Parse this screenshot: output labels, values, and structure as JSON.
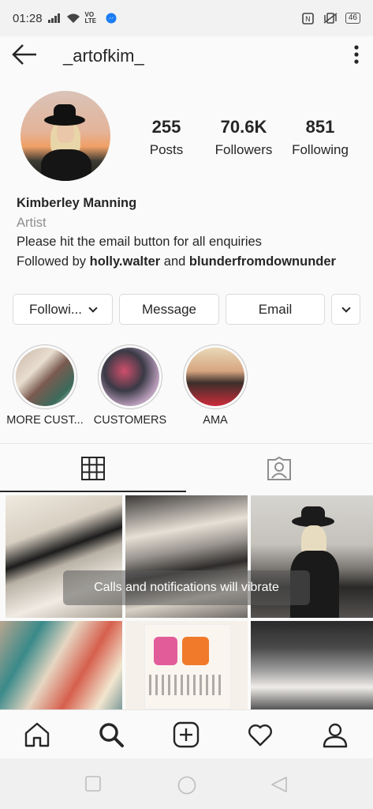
{
  "status_bar": {
    "time": "01:28",
    "network": "VO LTE",
    "battery": "46"
  },
  "header": {
    "username": "_artofkim_"
  },
  "profile": {
    "posts": "255",
    "posts_label": "Posts",
    "followers": "70.6K",
    "followers_label": "Followers",
    "following": "851",
    "following_label": "Following",
    "name": "Kimberley Manning",
    "category": "Artist",
    "bio": "Please hit the email button for all enquiries",
    "followed_by_prefix": "Followed by ",
    "followed_by_1": "holly.walter",
    "followed_by_and": " and ",
    "followed_by_2": "blunderfromdownunder"
  },
  "buttons": {
    "following": "Followi...",
    "message": "Message",
    "email": "Email"
  },
  "highlights": [
    {
      "label": "MORE CUST..."
    },
    {
      "label": "CUSTOMERS"
    },
    {
      "label": "AMA"
    }
  ],
  "toast": "Calls and notifications will vibrate",
  "icons": {
    "back": "back-arrow-icon",
    "more": "more-vertical-icon",
    "grid": "grid-icon",
    "tagged": "tagged-person-icon",
    "home": "home-icon",
    "search": "search-icon",
    "add": "add-post-icon",
    "activity": "heart-icon",
    "profile": "profile-icon"
  }
}
